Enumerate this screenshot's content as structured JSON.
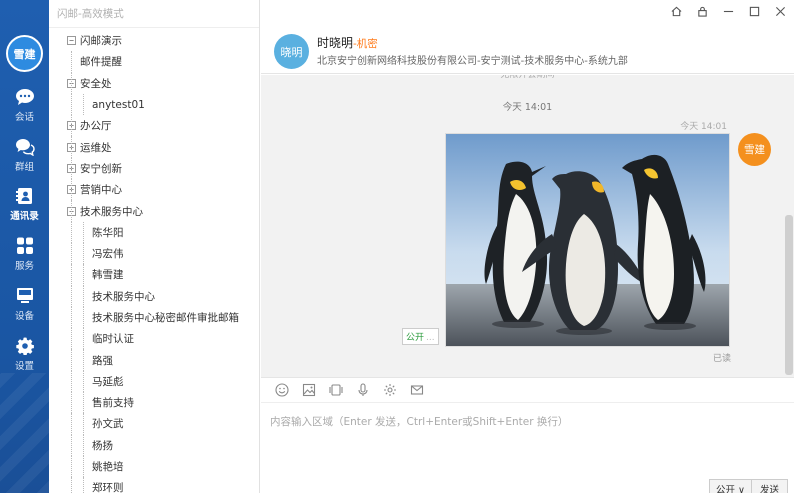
{
  "window": {
    "title": "闪邮-高效模式"
  },
  "nav": {
    "avatar_text": "雪建",
    "items": [
      {
        "label": "会话",
        "icon": "chat-bubble-icon"
      },
      {
        "label": "群组",
        "icon": "group-chat-icon"
      },
      {
        "label": "通讯录",
        "icon": "contacts-icon"
      },
      {
        "label": "服务",
        "icon": "services-grid-icon"
      },
      {
        "label": "设备",
        "icon": "device-icon"
      },
      {
        "label": "设置",
        "icon": "gear-icon"
      }
    ]
  },
  "tree": [
    {
      "label": "闪邮演示",
      "toggle": "⊟"
    },
    {
      "label": "邮件提醒",
      "toggle": ""
    },
    {
      "label": "安全处",
      "toggle": "⊟"
    },
    {
      "label": "anytest01",
      "toggle": ""
    },
    {
      "label": "办公厅",
      "toggle": "⊞"
    },
    {
      "label": "运维处",
      "toggle": "⊞"
    },
    {
      "label": "安宁创新",
      "toggle": "⊞"
    },
    {
      "label": "营销中心",
      "toggle": "⊞"
    },
    {
      "label": "技术服务中心",
      "toggle": "⊟"
    },
    {
      "label": "陈华阳",
      "toggle": ""
    },
    {
      "label": "冯宏伟",
      "toggle": ""
    },
    {
      "label": "韩雪建",
      "toggle": ""
    },
    {
      "label": "技术服务中心",
      "toggle": ""
    },
    {
      "label": "技术服务中心秘密邮件审批邮箱",
      "toggle": ""
    },
    {
      "label": "临时认证",
      "toggle": ""
    },
    {
      "label": "路强",
      "toggle": ""
    },
    {
      "label": "马延彪",
      "toggle": ""
    },
    {
      "label": "售前支持",
      "toggle": ""
    },
    {
      "label": "孙文武",
      "toggle": ""
    },
    {
      "label": "杨扬",
      "toggle": ""
    },
    {
      "label": "姚艳培",
      "toggle": ""
    },
    {
      "label": "郑环则",
      "toggle": ""
    }
  ],
  "chat": {
    "contact_avatar": "晓明",
    "contact_name": "时晓明",
    "contact_secret": "-机密",
    "contact_org": "北京安宁创新网络科技股份有限公司-安宁测试-技术服务中心-系统九部",
    "old_message": "无限开会期间",
    "time_separator": "今天 14:01",
    "message_time": "今天 14:01",
    "sender_avatar": "雪建",
    "public_tag": "公开",
    "public_tag_more": "...",
    "read_status": "已读",
    "input_placeholder": "内容输入区域（Enter 发送，Ctrl+Enter或Shift+Enter 换行）",
    "btn_public": "公开 ∨",
    "btn_send": "发送",
    "toolbar": [
      "emoji-icon",
      "image-icon",
      "screenshot-icon",
      "microphone-icon",
      "settings-icon",
      "mail-icon"
    ]
  },
  "colors": {
    "nav_bg": "#1f5fb0",
    "secret": "#ff7a1a",
    "sender_avatar": "#f4901e",
    "contact_avatar": "#5ab0e0",
    "public_green": "#2b9b3c"
  }
}
